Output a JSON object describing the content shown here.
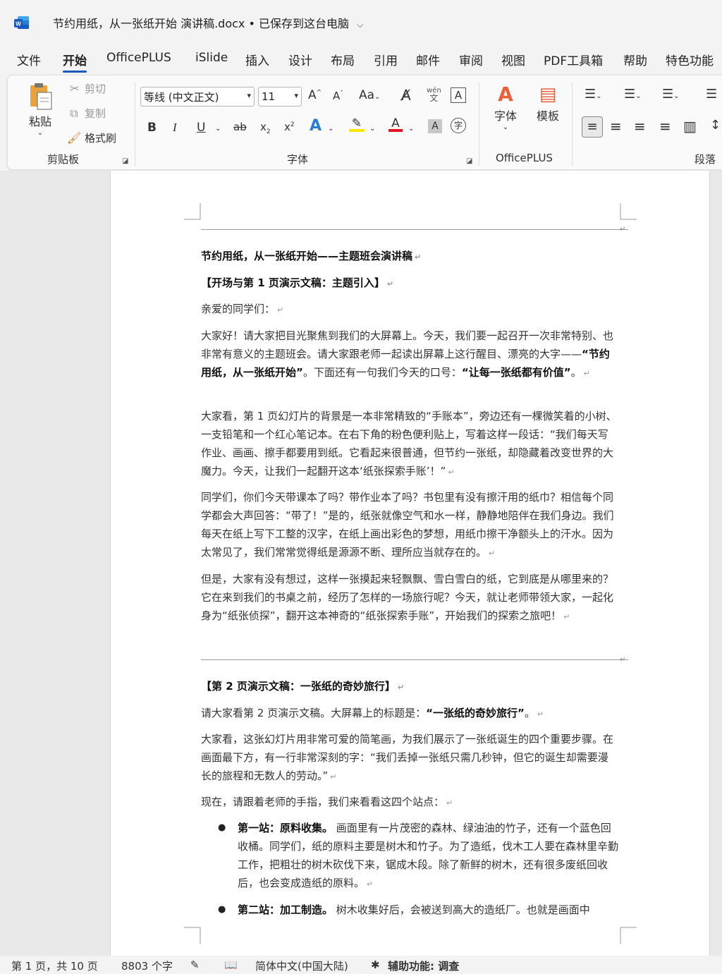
{
  "window": {
    "title": "节约用纸，从一张纸开始 演讲稿.docx • 已保存到这台电脑",
    "app_icon": "word-icon",
    "chevron": "⌵"
  },
  "tabs": [
    "文件",
    "开始",
    "OfficePLUS",
    "iSlide",
    "插入",
    "设计",
    "布局",
    "引用",
    "邮件",
    "审阅",
    "视图",
    "PDF工具箱",
    "帮助",
    "特色功能"
  ],
  "ribbon": {
    "clipboard": {
      "label": "剪贴板",
      "paste": "粘贴",
      "cut": "剪切",
      "copy": "复制",
      "format_painter": "格式刷"
    },
    "font": {
      "label": "字体",
      "font_name": "等线 (中文正文)",
      "font_size": "11"
    },
    "officeplus": {
      "label": "OfficePLUS",
      "font_btn": "字体",
      "template_btn": "模板"
    },
    "paragraph": {
      "label": "段落"
    },
    "colors": {
      "accent": "#185abd",
      "highlight": "#ffe600",
      "font_color": "#e81123"
    }
  },
  "document": {
    "heading": "节约用纸，从一张纸开始——主题班会演讲稿",
    "section1": "【开场与第 1 页演示文稿：主题引入】",
    "greeting": "亲爱的同学们：",
    "p1_a": "大家好！请大家把目光聚焦到我们的大屏幕上。今天，我们要一起召开一次非常特别、也非常有意义的主题班会。请大家跟老师一起读出屏幕上这行醒目、漂亮的大字——",
    "p1_b": "“节约用纸，从一张纸开始”",
    "p1_c": "。下面还有一句我们今天的口号：",
    "p1_d": "“让每一张纸都有价值”",
    "p1_e": "。",
    "p2": "大家看，第 1 页幻灯片的背景是一本非常精致的“手账本”，旁边还有一棵微笑着的小树、一支铅笔和一个红心笔记本。在右下角的粉色便利贴上，写着这样一段话：“我们每天写作业、画画、擦手都要用到纸。它看起来很普通，但节约一张纸，却隐藏着改变世界的大魔力。今天，让我们一起翻开这本‘纸张探索手账’！”",
    "p3": "同学们，你们今天带课本了吗？带作业本了吗？书包里有没有擦汗用的纸巾？相信每个同学都会大声回答：“带了！”是的，纸张就像空气和水一样，静静地陪伴在我们身边。我们每天在纸上写下工整的汉字，在纸上画出彩色的梦想，用纸巾擦干净额头上的汗水。因为太常见了，我们常常觉得纸是源源不断、理所应当就存在的。",
    "p4": "但是，大家有没有想过，这样一张摸起来轻飘飘、雪白雪白的纸，它到底是从哪里来的？它在来到我们的书桌之前，经历了怎样的一场旅行呢？今天，就让老师带领大家，一起化身为“纸张侦探”，翻开这本神奇的“纸张探索手账”，开始我们的探索之旅吧！",
    "section2": "【第 2 页演示文稿：一张纸的奇妙旅行】",
    "p5_a": "请大家看第 2 页演示文稿。大屏幕上的标题是：",
    "p5_b": "“一张纸的奇妙旅行”",
    "p5_c": "。",
    "p6": "大家看，这张幻灯片用非常可爱的简笔画，为我们展示了一张纸诞生的四个重要步骤。在画面最下方，有一行非常深刻的字：“我们丢掉一张纸只需几秒钟，但它的诞生却需要漫长的旅程和无数人的劳动。”",
    "p7": "现在，请跟着老师的手指，我们来看看这四个站点：",
    "li1_title": "第一站：原料收集。",
    "li1_text": " 画面里有一片茂密的森林、绿油油的竹子，还有一个蓝色回收桶。同学们，纸的原料主要是树木和竹子。为了造纸，伐木工人要在森林里辛勤工作，把粗壮的树木砍伐下来，锯成木段。除了新鲜的树木，还有很多废纸回收后，也会变成造纸的原料。",
    "li2_title": "第二站：加工制造。",
    "li2_text": " 树木收集好后，会被送到高大的造纸厂。也就是画面中",
    "para_mark": "↵"
  },
  "status": {
    "page": "第 1 页，共 10 页",
    "words": "8803 个字",
    "language": "简体中文(中国大陆)",
    "accessibility": "辅助功能: 调查"
  }
}
